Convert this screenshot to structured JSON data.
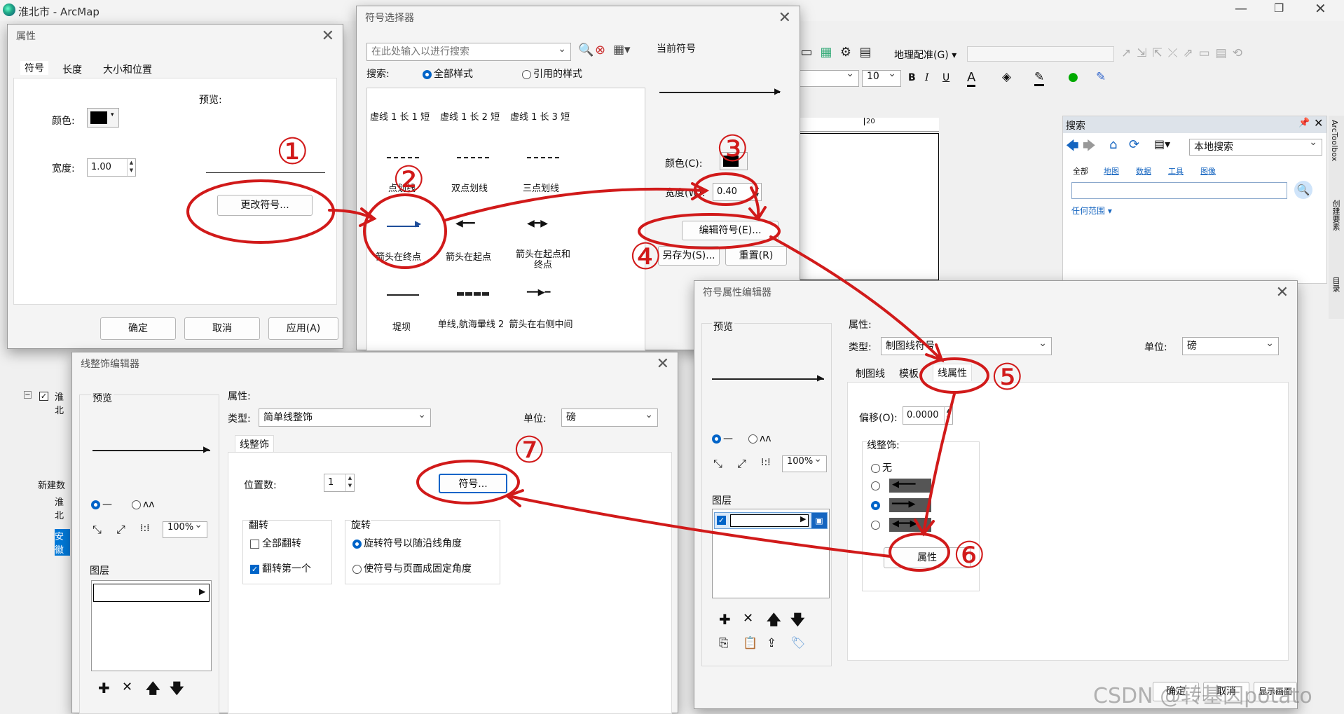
{
  "app": {
    "title": "淮北市 - ArcMap"
  },
  "main_toolbar": {
    "georef": "地理配准(G) ▾",
    "font_size": "10",
    "bold": "B",
    "italic": "I",
    "underline": "U",
    "ruler_mark": "20"
  },
  "search_panel": {
    "title": "搜索",
    "scope": "本地搜索",
    "tabs": [
      "全部",
      "地图",
      "数据",
      "工具",
      "图像"
    ],
    "extent": "任何范围 ▾"
  },
  "right_dock": {
    "items": [
      "ArcToolbox",
      "创建要素",
      "目录"
    ]
  },
  "toc": {
    "rows": [
      "淮北",
      "新建数",
      "淮北",
      "安徽"
    ]
  },
  "props": {
    "title": "属性",
    "tabs": [
      "符号",
      "长度",
      "大小和位置"
    ],
    "preview_label": "预览:",
    "color_label": "颜色:",
    "width_label": "宽度:",
    "width_value": "1.00",
    "change_symbol": "更改符号...",
    "ok": "确定",
    "cancel": "取消",
    "apply": "应用(A)"
  },
  "selector": {
    "title": "符号选择器",
    "search_placeholder": "在此处输入以进行搜索",
    "search_label": "搜索:",
    "radio_all": "全部样式",
    "radio_ref": "引用的样式",
    "current_label": "当前符号",
    "color_label": "颜色(C):",
    "width_label": "宽度(W):",
    "width_value": "0.40",
    "edit_symbol": "编辑符号(E)...",
    "save_as": "另存为(S)...",
    "reset": "重置(R)",
    "symbols": [
      "虚线 1 长 1 短",
      "虚线 1 长 2 短",
      "虚线 1 长 3 短",
      "点划线",
      "双点划线",
      "三点划线",
      "箭头在终点",
      "箭头在起点",
      "箭头在起点和终点",
      "堤坝",
      "单线,航海暈线 2",
      "箭头在右侧中间"
    ]
  },
  "spe": {
    "title": "符号属性编辑器",
    "preview": "预览",
    "props_label": "属性:",
    "type_label": "类型:",
    "type_value": "制图线符号",
    "unit_label": "单位:",
    "unit_value": "磅",
    "tabs": [
      "制图线",
      "模板",
      "线属性"
    ],
    "offset_label": "偏移(O):",
    "offset_value": "0.0000",
    "decor_label": "线整饰:",
    "decor_none": "无",
    "properties_btn": "属性",
    "zoom": "100%",
    "layers_label": "图层",
    "ok": "确定",
    "cancel": "取消",
    "show_dialog": "显示画面"
  },
  "lde": {
    "title": "线整饰编辑器",
    "preview": "预览",
    "props_label": "属性:",
    "type_label": "类型:",
    "type_value": "简单线整饰",
    "unit_label": "单位:",
    "unit_value": "磅",
    "tab": "线整饰",
    "pos_label": "位置数:",
    "pos_value": "1",
    "symbol_btn": "符号...",
    "flip_label": "翻转",
    "flip_all": "全部翻转",
    "flip_first": "翻转第一个",
    "rotate_label": "旋转",
    "rotate_follow": "旋转符号以随沿线角度",
    "rotate_fixed": "使符号与页面成固定角度",
    "zoom": "100%",
    "layers_label": "图层"
  },
  "annotations": {
    "n1": "①",
    "n2": "②",
    "n3": "③",
    "n4": "④",
    "n5": "⑤",
    "n6": "⑥",
    "n7": "⑦"
  },
  "watermark": "CSDN @转基因potato",
  "colors": {
    "annotation": "#d11a1a",
    "accent": "#0064c8"
  }
}
